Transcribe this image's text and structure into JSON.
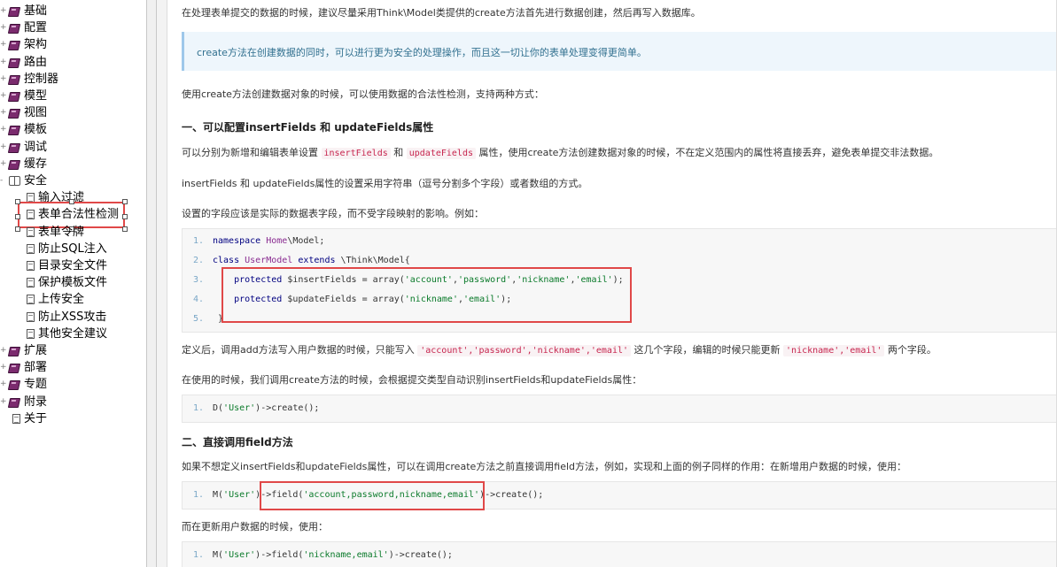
{
  "sidebar": {
    "items": [
      {
        "label": "基础",
        "type": "book"
      },
      {
        "label": "配置",
        "type": "book"
      },
      {
        "label": "架构",
        "type": "book"
      },
      {
        "label": "路由",
        "type": "book"
      },
      {
        "label": "控制器",
        "type": "book"
      },
      {
        "label": "模型",
        "type": "book"
      },
      {
        "label": "视图",
        "type": "book"
      },
      {
        "label": "模板",
        "type": "book"
      },
      {
        "label": "调试",
        "type": "book"
      },
      {
        "label": "缓存",
        "type": "book"
      },
      {
        "label": "安全",
        "type": "open-book"
      },
      {
        "label": "输入过滤",
        "type": "page"
      },
      {
        "label": "表单合法性检测",
        "type": "page",
        "selected": true
      },
      {
        "label": "表单令牌",
        "type": "page"
      },
      {
        "label": "防止SQL注入",
        "type": "page"
      },
      {
        "label": "目录安全文件",
        "type": "page"
      },
      {
        "label": "保护模板文件",
        "type": "page"
      },
      {
        "label": "上传安全",
        "type": "page"
      },
      {
        "label": "防止XSS攻击",
        "type": "page"
      },
      {
        "label": "其他安全建议",
        "type": "page"
      },
      {
        "label": "扩展",
        "type": "book"
      },
      {
        "label": "部署",
        "type": "book"
      },
      {
        "label": "专题",
        "type": "book"
      },
      {
        "label": "附录",
        "type": "book"
      },
      {
        "label": "关于",
        "type": "page-root"
      }
    ]
  },
  "content": {
    "intro": "在处理表单提交的数据的时候，建议尽量采用Think\\Model类提供的create方法首先进行数据创建，然后再写入数据库。",
    "note": "create方法在创建数据的同时，可以进行更为安全的处理操作，而且这一切让你的表单处理变得更简单。",
    "p1": "使用create方法创建数据对象的时候，可以使用数据的合法性检测，支持两种方式：",
    "h1": "一、可以配置insertFields 和 updateFields属性",
    "p2_a": "可以分别为新增和编辑表单设置",
    "p2_code1": "insertFields",
    "p2_b": "和",
    "p2_code2": "updateFields",
    "p2_c": "属性，使用create方法创建数据对象的时候，不在定义范围内的属性将直接丢弃，避免表单提交非法数据。",
    "p3": "insertFields 和 updateFields属性的设置采用字符串（逗号分割多个字段）或者数组的方式。",
    "p4": "设置的字段应该是实际的数据表字段，而不受字段映射的影响。例如：",
    "code1": [
      {
        "n": "1.",
        "parts": [
          [
            "kw",
            "namespace "
          ],
          [
            "cls",
            "Home"
          ],
          [
            "var",
            "\\Model;"
          ]
        ]
      },
      {
        "n": "2.",
        "parts": [
          [
            "kw",
            "class "
          ],
          [
            "cls",
            "UserModel "
          ],
          [
            "kw",
            "extends "
          ],
          [
            "var",
            "\\Think\\Model{"
          ]
        ]
      },
      {
        "n": "3.",
        "parts": [
          [
            "var",
            "    "
          ],
          [
            "kw",
            "protected "
          ],
          [
            "var",
            "$insertFields = array("
          ],
          [
            "str",
            "'account'"
          ],
          [
            "var",
            ","
          ],
          [
            "str",
            "'password'"
          ],
          [
            "var",
            ","
          ],
          [
            "str",
            "'nickname'"
          ],
          [
            "var",
            ","
          ],
          [
            "str",
            "'email'"
          ],
          [
            "var",
            ");"
          ]
        ]
      },
      {
        "n": "4.",
        "parts": [
          [
            "var",
            "    "
          ],
          [
            "kw",
            "protected "
          ],
          [
            "var",
            "$updateFields = array("
          ],
          [
            "str",
            "'nickname'"
          ],
          [
            "var",
            ","
          ],
          [
            "str",
            "'email'"
          ],
          [
            "var",
            ");"
          ]
        ]
      },
      {
        "n": "5.",
        "parts": [
          [
            "var",
            " }"
          ]
        ]
      }
    ],
    "p5_a": "定义后，调用add方法写入用户数据的时候，只能写入",
    "p5_code1": "'account','password','nickname','email'",
    "p5_b": "这几个字段，编辑的时候只能更新",
    "p5_code2": "'nickname','email'",
    "p5_c": "两个字段。",
    "p6": "在使用的时候，我们调用create方法的时候，会根据提交类型自动识别insertFields和updateFields属性：",
    "code2": [
      {
        "n": "1.",
        "parts": [
          [
            "var",
            "D("
          ],
          [
            "str",
            "'User'"
          ],
          [
            "var",
            ")->create();"
          ]
        ]
      }
    ],
    "h2": "二、直接调用field方法",
    "p7": "如果不想定义insertFields和updateFields属性，可以在调用create方法之前直接调用field方法，例如，实现和上面的例子同样的作用：在新增用户数据的时候，使用：",
    "code3": [
      {
        "n": "1.",
        "parts": [
          [
            "var",
            "M("
          ],
          [
            "str",
            "'User'"
          ],
          [
            "var",
            ")->field("
          ],
          [
            "str",
            "'account,password,nickname,email'"
          ],
          [
            "var",
            ")->create();"
          ]
        ]
      }
    ],
    "p8": "而在更新用户数据的时候，使用：",
    "code4": [
      {
        "n": "1.",
        "parts": [
          [
            "var",
            "M("
          ],
          [
            "str",
            "'User'"
          ],
          [
            "var",
            ")->field("
          ],
          [
            "str",
            "'nickname,email'"
          ],
          [
            "var",
            ")->create();"
          ]
        ]
      }
    ]
  }
}
